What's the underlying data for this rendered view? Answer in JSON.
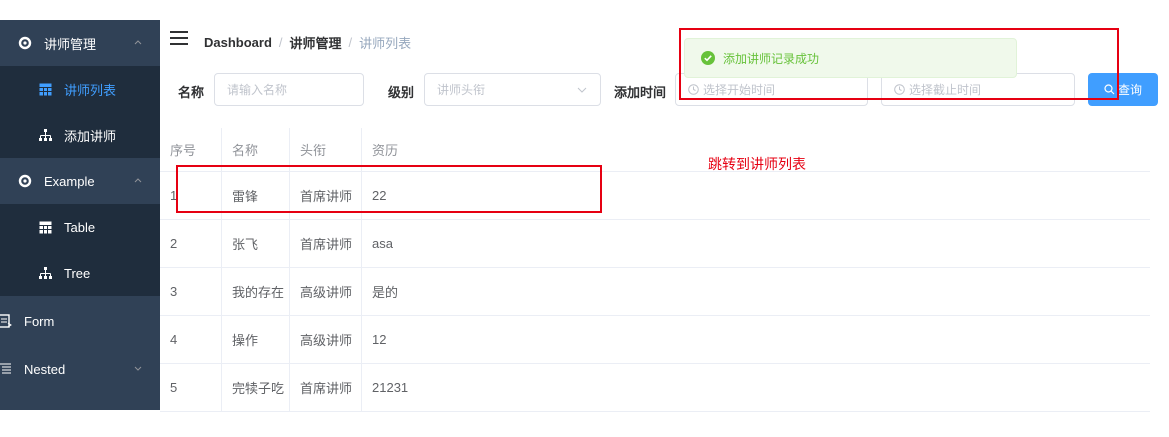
{
  "sidebar": {
    "items": [
      {
        "label": "讲师管理",
        "icon": "gear-icon"
      },
      {
        "label": "讲师列表",
        "icon": "table-icon"
      },
      {
        "label": "添加讲师",
        "icon": "tree-icon"
      },
      {
        "label": "Example",
        "icon": "gear-icon"
      },
      {
        "label": "Table",
        "icon": "table-icon"
      },
      {
        "label": "Tree",
        "icon": "tree-icon"
      },
      {
        "label": "Form",
        "icon": "form-icon"
      },
      {
        "label": "Nested",
        "icon": "nested-icon"
      }
    ]
  },
  "breadcrumb": {
    "home": "Dashboard",
    "section": "讲师管理",
    "current": "讲师列表",
    "separator": "/"
  },
  "search": {
    "name_label": "名称",
    "name_placeholder": "请输入名称",
    "level_label": "级别",
    "level_placeholder": "讲师头衔",
    "time_label": "添加时间",
    "start_placeholder": "选择开始时间",
    "end_placeholder": "选择截止时间",
    "query_label": "查询"
  },
  "table": {
    "headers": [
      "序号",
      "名称",
      "头衔",
      "资历"
    ],
    "rows": [
      [
        "1",
        "雷锋",
        "首席讲师",
        "22"
      ],
      [
        "2",
        "张飞",
        "首席讲师",
        "asa"
      ],
      [
        "3",
        "我的存在",
        "高级讲师",
        "是的"
      ],
      [
        "4",
        "操作",
        "高级讲师",
        "12"
      ],
      [
        "5",
        "完犊子吃",
        "首席讲师",
        "21231"
      ]
    ]
  },
  "notification": {
    "message": "添加讲师记录成功",
    "type": "success"
  },
  "annotation": {
    "text": "跳转到讲师列表"
  },
  "colors": {
    "sidebar_bg": "#304156",
    "submenu_bg": "#1f2d3d",
    "active": "#409eff",
    "success": "#67c23a",
    "annotation": "#e60012"
  }
}
